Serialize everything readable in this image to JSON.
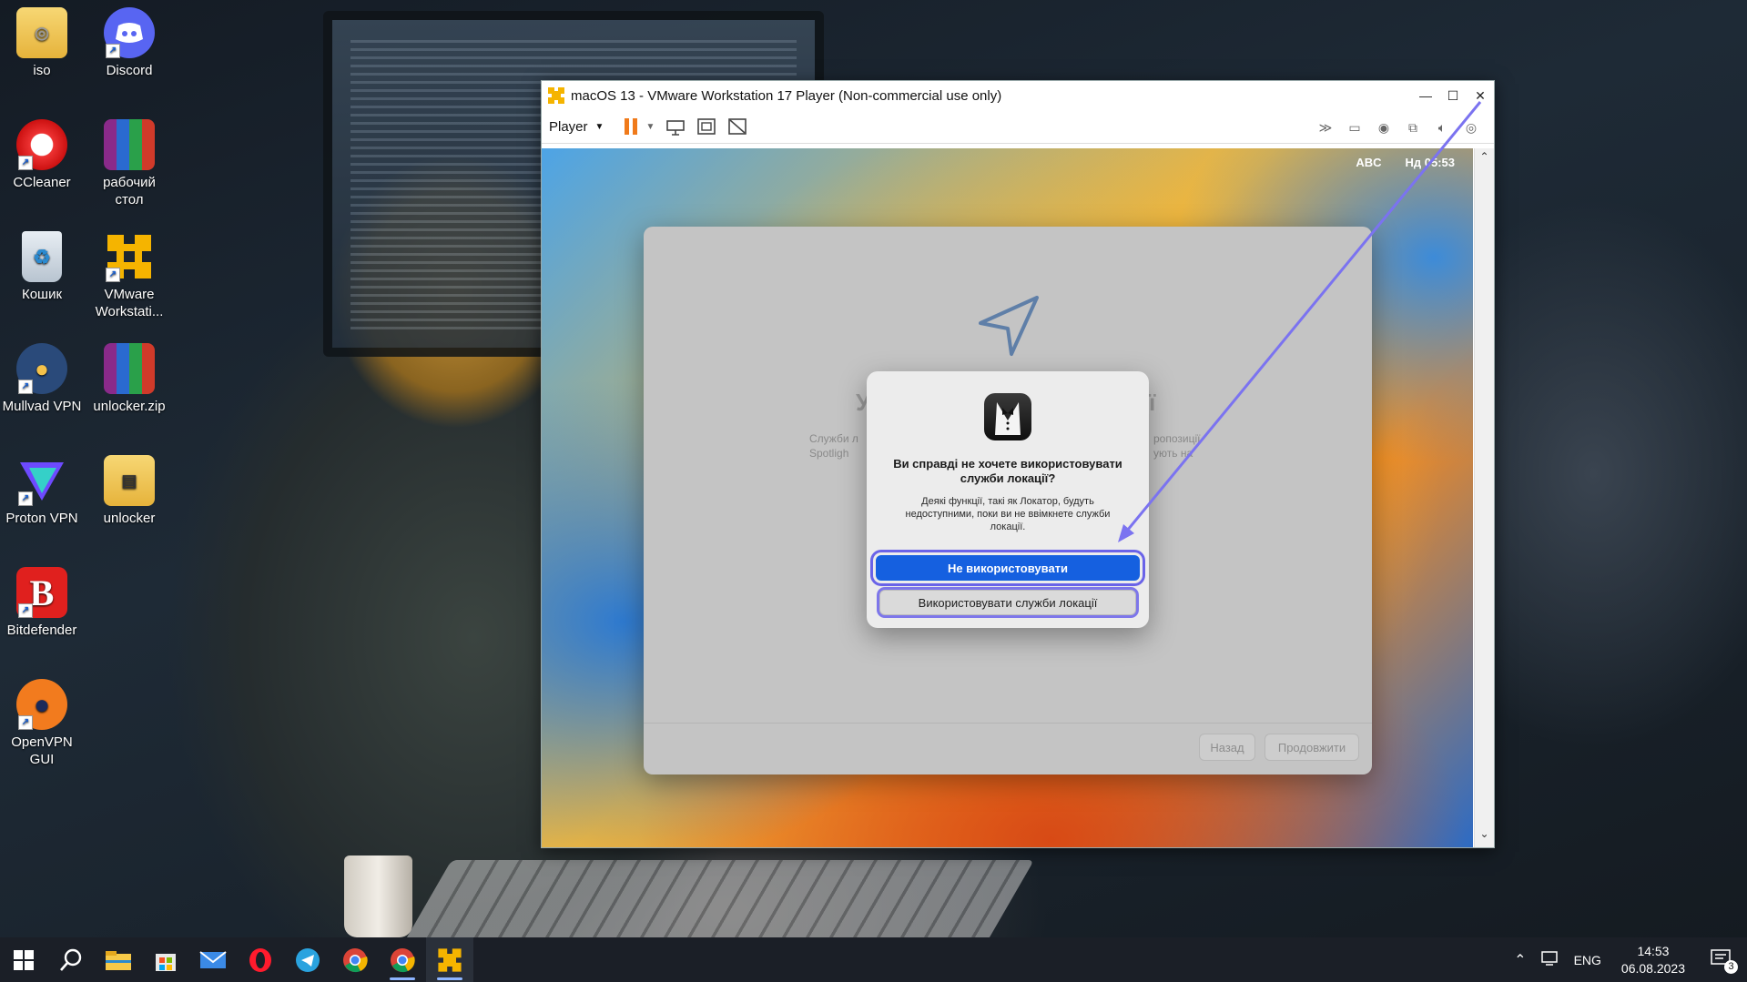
{
  "desktop": {
    "icons": [
      {
        "label": "iso",
        "icon": "folder-icon"
      },
      {
        "label": "Discord",
        "icon": "discord-icon"
      },
      {
        "label": "CCleaner",
        "icon": "ccleaner-icon"
      },
      {
        "label": "рабочий стол",
        "icon": "winrar-archive-icon"
      },
      {
        "label": "Кошик",
        "icon": "recycle-bin-icon"
      },
      {
        "label": "VMware Workstati...",
        "icon": "vmware-icon"
      },
      {
        "label": "Mullvad VPN",
        "icon": "mullvad-icon"
      },
      {
        "label": "unlocker.zip",
        "icon": "winrar-archive-icon"
      },
      {
        "label": "Proton VPN",
        "icon": "protonvpn-icon"
      },
      {
        "label": "unlocker",
        "icon": "folder-icon"
      },
      {
        "label": "Bitdefender",
        "icon": "bitdefender-icon"
      },
      {
        "label": "OpenVPN GUI",
        "icon": "openvpn-icon"
      }
    ]
  },
  "vm_window": {
    "title": "macOS 13 - VMware Workstation 17 Player (Non-commercial use only)",
    "toolbar": {
      "player_label": "Player"
    }
  },
  "guest": {
    "menubar": {
      "input_source": "ABC",
      "clock": "Нд 05:53"
    },
    "setup_panel": {
      "title_left_fragment": "У",
      "title_right_fragment": "ї",
      "desc_left_line1": "Служби л",
      "desc_left_line2": "Spotligh",
      "desc_right_line1": "ропозиції",
      "desc_right_line2": "ують на",
      "back_button": "Назад",
      "continue_button": "Продовжити"
    },
    "dialog": {
      "title": "Ви справді не хочете використовувати служби локації?",
      "message": "Деякі функції, такі як Локатор, будуть недоступними, поки ви не ввімкнете служби локації.",
      "primary_button": "Не використовувати",
      "secondary_button": "Використовувати служби локації"
    }
  },
  "taskbar": {
    "tray": {
      "language": "ENG",
      "time": "14:53",
      "date": "06.08.2023",
      "notifications_count": "3"
    }
  },
  "colors": {
    "accent_blue": "#1560e0",
    "annotation_purple": "#6a63e8"
  }
}
